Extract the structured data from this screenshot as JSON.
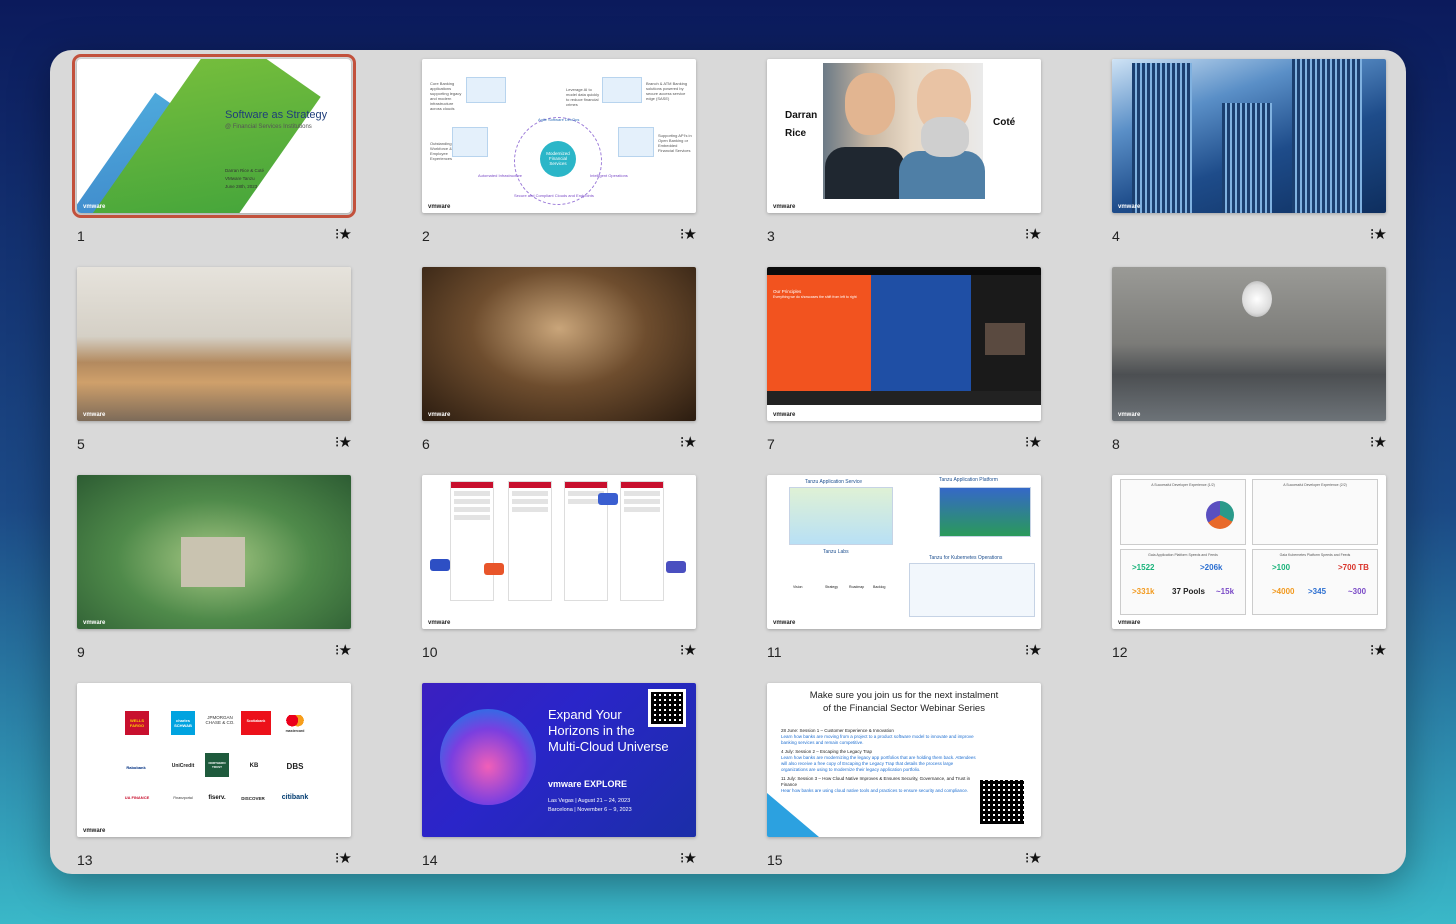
{
  "slides": [
    {
      "number": "1",
      "title": "Software as Strategy",
      "subtitle": "@ Financial Services Institutions",
      "authors": "Darran Rice & Coté",
      "org": "VMware Tanzu",
      "date": "June 28th, 2023",
      "logo": "vmware"
    },
    {
      "number": "2",
      "center": "Modernized Financial Services",
      "labels": [
        "Core Banking applications supporting legacy and modern infrastructure across clouds",
        "Leverage AI to model data quickly to reduce financial crimes",
        "Branch & ATM Banking solutions powered by secure access service edge (SASE)",
        "Outstanding Workforce & Employee Experiences",
        "Supporting API's in Open Banking or Embedded Financial Services",
        "Agile Software DevOps",
        "Automated Infrastructure",
        "Intelligent Operations",
        "Secure and Compliant Clouds and Endpoints"
      ],
      "logo": "vmware"
    },
    {
      "number": "3",
      "name_left": [
        "Darran",
        "Rice"
      ],
      "name_right": "Coté",
      "logo": "vmware"
    },
    {
      "number": "4",
      "logo": "vmware"
    },
    {
      "number": "5",
      "logo": "vmware"
    },
    {
      "number": "6",
      "logo": "vmware"
    },
    {
      "number": "7",
      "heading": "Our Principles",
      "subheading": "Everything we do showcases the shift from left to right",
      "logo": "vmware"
    },
    {
      "number": "8",
      "logo": "vmware"
    },
    {
      "number": "9",
      "logo": "vmware"
    },
    {
      "number": "10",
      "logo": "vmware"
    },
    {
      "number": "11",
      "titles": [
        "Tanzu Application Service",
        "Tanzu Application Platform",
        "Tanzu Labs",
        "Tanzu for Kubernetes Operations"
      ],
      "labels": [
        "Vision",
        "Strategy",
        "Roadmap",
        "Backlog"
      ],
      "logo": "vmware"
    },
    {
      "number": "12",
      "cards": [
        "A Successful Developer Experience (1/2)",
        "A Successful Developer Experience (2/2)",
        "Gaia Application Platform Speeds and Feeds",
        "Gaia Kubernetes Platform Speeds and Feeds"
      ],
      "stats_left": [
        ">1522",
        ">206k",
        ">331k",
        "37 Pools",
        "~15k"
      ],
      "stats_right": [
        ">100",
        ">700 TB",
        ">4000",
        ">345",
        "~300"
      ],
      "logo": "vmware"
    },
    {
      "number": "13",
      "logos": [
        "WELLS FARGO",
        "charles SCHWAB",
        "JPMORGAN CHASE & CO.",
        "Scotiabank",
        "mastercard",
        "Rabobank",
        "UniCredit",
        "NORTHERN TRUST",
        "KB",
        "DBS",
        "UA FINANCE",
        "Finanzportal",
        "fiserv.",
        "DISCOVER",
        "citibank"
      ],
      "logo": "vmware"
    },
    {
      "number": "14",
      "title_lines": [
        "Expand Your",
        "Horizons in the",
        "Multi-Cloud Universe"
      ],
      "event": "vmware EXPLORE",
      "dates": [
        "Las Vegas | August 21 – 24, 2023",
        "Barcelona | November 6 – 9, 2023"
      ]
    },
    {
      "number": "15",
      "heading_lines": [
        "Make sure you join us for the next instalment",
        "of the Financial Sector Webinar Series"
      ],
      "sessions": [
        {
          "title": "28 June: Session 1 – Customer Experience & Innovation",
          "desc": "Learn how banks are moving from a project to a product software model to innovate and improve banking services and remain competitive."
        },
        {
          "title": "4 July: Session 2 – Escaping the Legacy Trap",
          "desc": "Learn how banks are modernizing the legacy app portfolios that are holding them back. Attendees will also receive a free copy of Escaping the Legacy Trap that details the process large organizations are using to modernize their legacy application portfolio."
        },
        {
          "title": "11 July: Session 3 – How Cloud Native Improves & Ensures Security, Governance, and Trust in Finance",
          "desc": "Hear how banks are using cloud native tools and practices to ensure security and compliance."
        }
      ]
    }
  ],
  "favorite_icon": "star-icon",
  "colors": {
    "selected_border": "#c2513c",
    "window_bg": "#d9d9d9"
  }
}
